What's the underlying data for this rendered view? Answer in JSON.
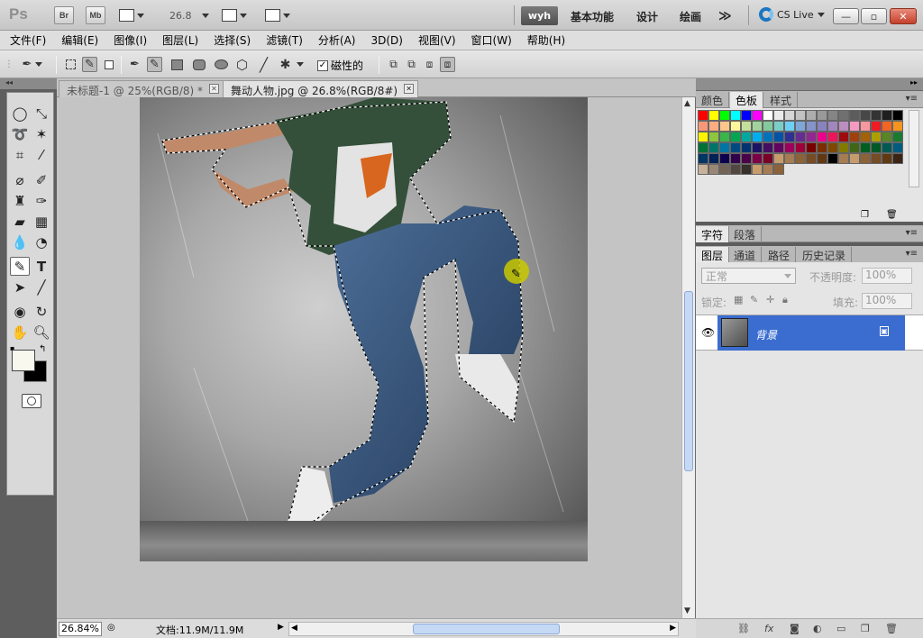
{
  "app": {
    "logo": "Ps",
    "bridge": "Br",
    "mini_bridge": "Mb",
    "zoom_dropdown": "26.8",
    "workspaces": {
      "active": "wyh",
      "items": [
        "基本功能",
        "设计",
        "绘画"
      ],
      "more": "≫"
    },
    "cs_live": "CS Live",
    "window_buttons": {
      "minimize": "—",
      "restore": "▫",
      "close": "✕"
    }
  },
  "menu": [
    "文件(F)",
    "编辑(E)",
    "图像(I)",
    "图层(L)",
    "选择(S)",
    "滤镜(T)",
    "分析(A)",
    "3D(D)",
    "视图(V)",
    "窗口(W)",
    "帮助(H)"
  ],
  "options_bar": {
    "magnetic_label": "磁性的",
    "magnetic_checked": true
  },
  "documents": {
    "tabs": [
      {
        "title": "未标题-1 @ 25%(RGB/8) *",
        "active": false
      },
      {
        "title": "舞动人物.jpg @ 26.8%(RGB/8#)",
        "active": true
      }
    ]
  },
  "status": {
    "zoom": "26.84%",
    "doc_info": "文档:11.9M/11.9M"
  },
  "panels": {
    "color_group": {
      "tabs": [
        "颜色",
        "色板",
        "样式"
      ],
      "active": "色板"
    },
    "char_group": {
      "tabs": [
        "字符",
        "段落"
      ],
      "active": "字符"
    },
    "layers_group": {
      "tabs": [
        "图层",
        "通道",
        "路径",
        "历史记录"
      ],
      "active": "图层"
    },
    "layers": {
      "blend_mode": "正常",
      "opacity_label": "不透明度:",
      "opacity": "100%",
      "lock_label": "锁定:",
      "fill_label": "填充:",
      "fill": "100%",
      "items": [
        {
          "name": "背景",
          "locked": true,
          "visible": true
        }
      ]
    }
  },
  "colors": {
    "swatch_rows": [
      [
        "#ff0000",
        "#ffff00",
        "#00ff00",
        "#00ffff",
        "#0000ff",
        "#ff00ff",
        "#ffffff",
        "#ebebeb",
        "#d6d6d6",
        "#c2c2c2",
        "#adadad",
        "#999999",
        "#858585",
        "#707070",
        "#5c5c5c",
        "#474747",
        "#333333",
        "#1f1f1f",
        "#000000"
      ],
      [
        "#f7977a",
        "#f9ad81",
        "#fdc68a",
        "#fff79a",
        "#c4df9b",
        "#a2d39c",
        "#82ca9d",
        "#7bcdc8",
        "#6ecff6",
        "#7ea7d8",
        "#8493ca",
        "#8882be",
        "#a187be",
        "#bc8dbf",
        "#f49ac2",
        "#f6989d",
        "#ee1c24",
        "#f26522",
        "#f7941d"
      ],
      [
        "#fff200",
        "#8dc63f",
        "#39b54a",
        "#00a651",
        "#00a99d",
        "#00aeef",
        "#0072bc",
        "#0054a6",
        "#2e3192",
        "#662d91",
        "#92278f",
        "#ec008c",
        "#ed145b",
        "#9e0b0f",
        "#a0410d",
        "#a36209",
        "#aba000",
        "#598527",
        "#197b30"
      ],
      [
        "#007236",
        "#00746b",
        "#0076a3",
        "#004a80",
        "#003471",
        "#1b1464",
        "#440e62",
        "#630460",
        "#9e005d",
        "#9e0039",
        "#790000",
        "#7b2e00",
        "#7d4900",
        "#827b00",
        "#406618",
        "#005e20",
        "#005826",
        "#005952",
        "#005b7f"
      ],
      [
        "#003663",
        "#002157",
        "#0d004c",
        "#32004b",
        "#4b0049",
        "#7b0046",
        "#7a0026",
        "#c69c6d",
        "#a67c52",
        "#8c6239",
        "#754c24",
        "#603913",
        "#000000",
        "#a67c52",
        "#c69c6d",
        "#8c6239",
        "#754c24",
        "#603913",
        "#3c2415"
      ],
      [
        "#c7b299",
        "#998675",
        "#736357",
        "#534741",
        "#37302a",
        "#c69c6d",
        "#a67c52",
        "#8c6239"
      ]
    ]
  }
}
